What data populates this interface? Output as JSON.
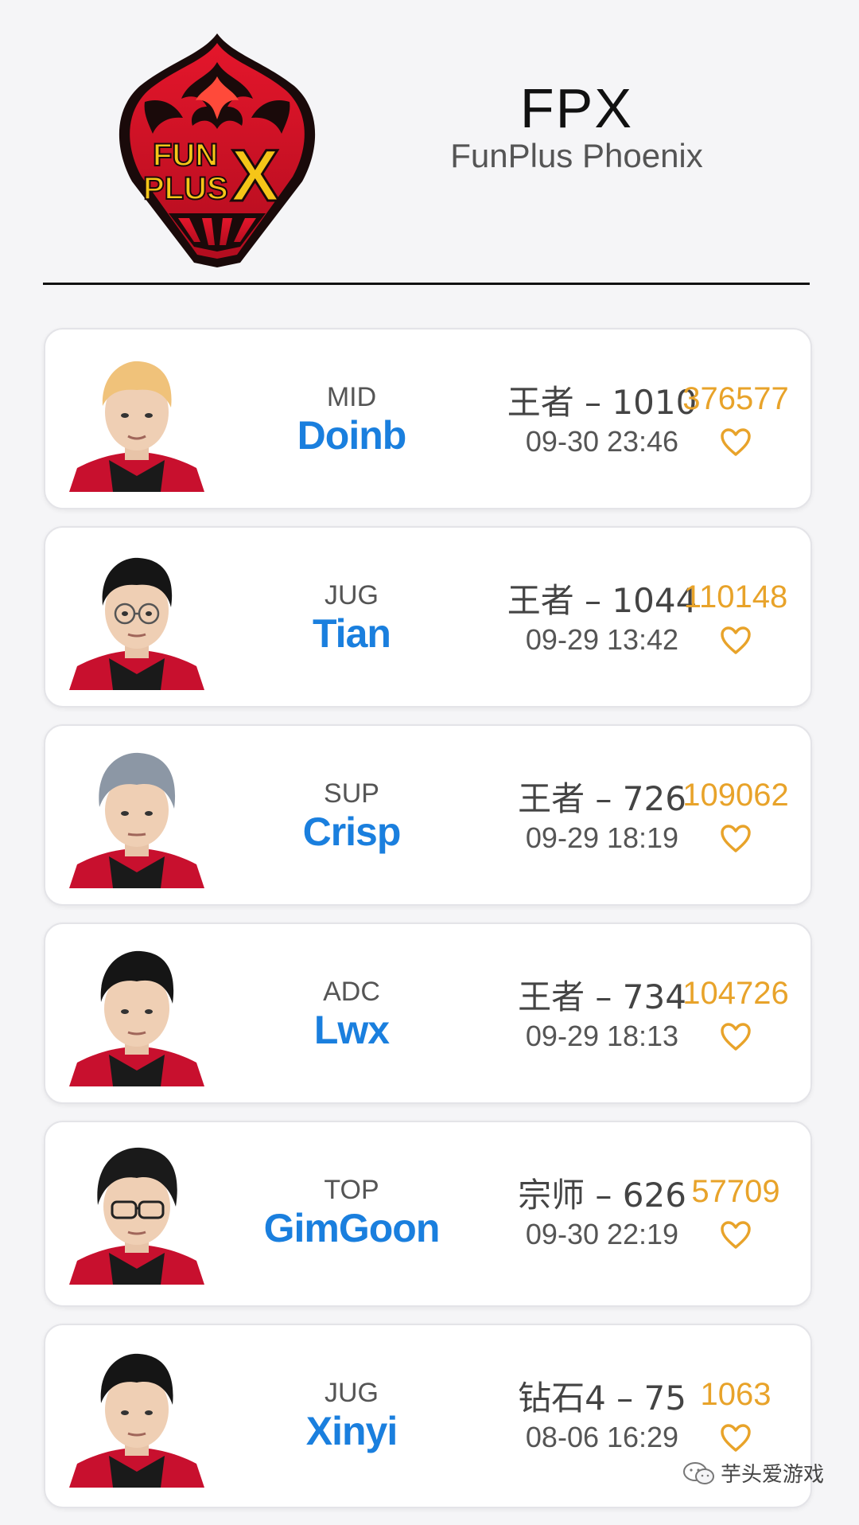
{
  "team": {
    "logo_text_line1": "FUN",
    "logo_text_line2": "PLUS",
    "logo_text_x": "X",
    "abbr": "FPX",
    "full_name": "FunPlus Phoenix"
  },
  "players": [
    {
      "role": "MID",
      "name": "Doinb",
      "rank": "王者 – 1010",
      "time": "09-30 23:46",
      "likes": "376577",
      "hair": "#f0c27a"
    },
    {
      "role": "JUG",
      "name": "Tian",
      "rank": "王者 – 1044",
      "time": "09-29 13:42",
      "likes": "110148",
      "hair": "#151515"
    },
    {
      "role": "SUP",
      "name": "Crisp",
      "rank": "王者 – 726",
      "time": "09-29 18:19",
      "likes": "109062",
      "hair": "#8c97a5"
    },
    {
      "role": "ADC",
      "name": "Lwx",
      "rank": "王者 – 734",
      "time": "09-29 18:13",
      "likes": "104726",
      "hair": "#151515"
    },
    {
      "role": "TOP",
      "name": "GimGoon",
      "rank": "宗师 – 626",
      "time": "09-30 22:19",
      "likes": "57709",
      "hair": "#1a1a1a"
    },
    {
      "role": "JUG",
      "name": "Xinyi",
      "rank": "钻石4 – 75",
      "time": "08-06 16:29",
      "likes": "1063",
      "hair": "#151515"
    }
  ],
  "colors": {
    "name_blue": "#1a7fde",
    "likes_gold": "#e8a32a",
    "jersey_red": "#c8102e"
  },
  "icons": {
    "heart": "heart-outline-icon",
    "wechat": "wechat-icon"
  },
  "watermark": {
    "text": "芋头爱游戏"
  }
}
